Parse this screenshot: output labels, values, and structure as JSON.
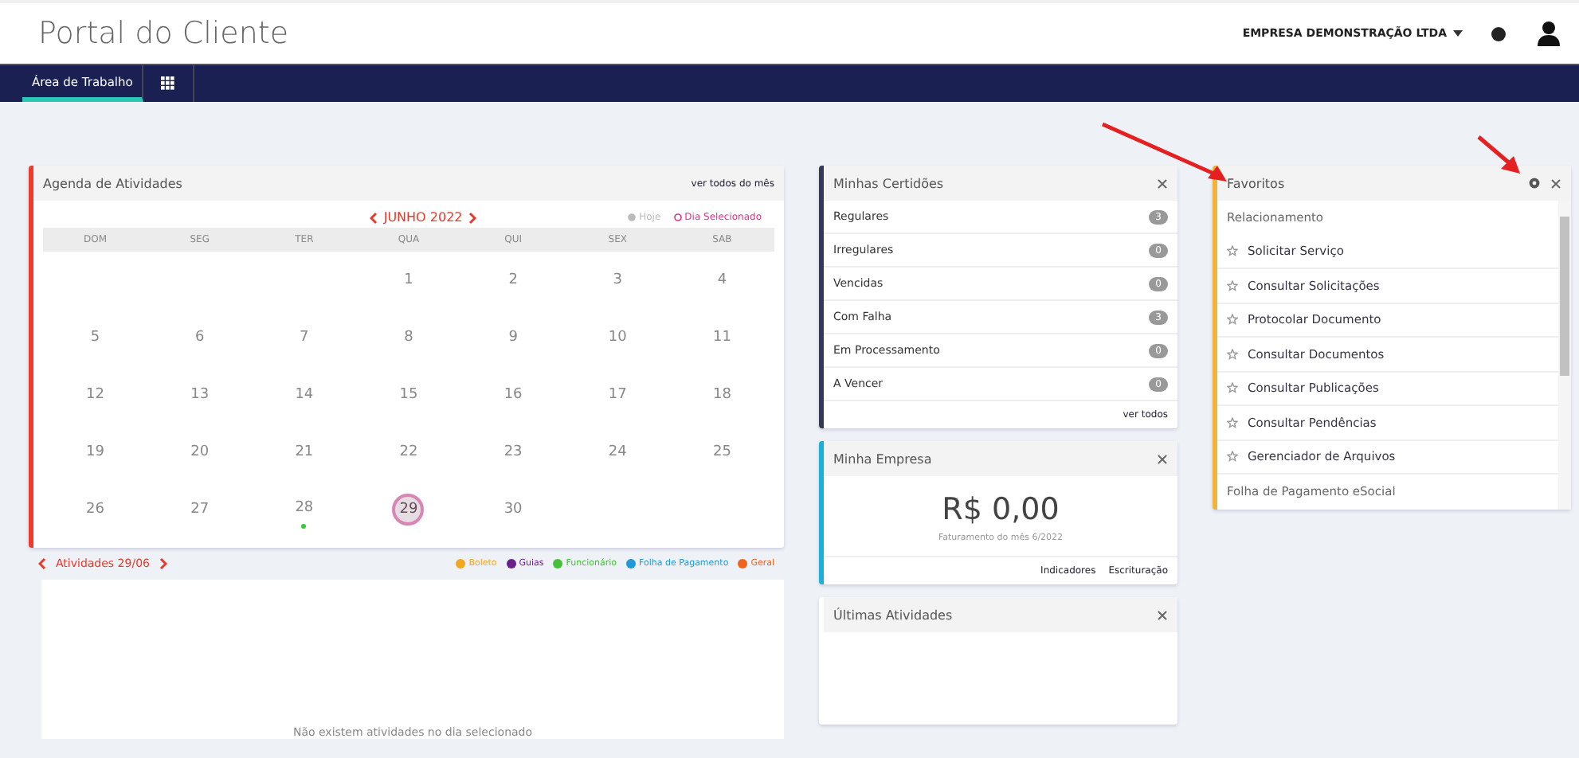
{
  "header": {
    "title": "Portal do Cliente",
    "company": "EMPRESA DEMONSTRAÇÃO LTDA"
  },
  "nav": {
    "tabs": [
      {
        "label": "Área de Trabalho",
        "selected": true
      }
    ]
  },
  "agenda": {
    "title": "Agenda de Atividades",
    "link": "ver todos do mês",
    "month": "JUNHO 2022",
    "legend_today": "Hoje",
    "legend_selected": "Dia Selecionado",
    "weekdays": [
      "DOM",
      "SEG",
      "TER",
      "QUA",
      "QUI",
      "SEX",
      "SAB"
    ],
    "days": [
      {
        "kind": "blank"
      },
      {
        "kind": "blank"
      },
      {
        "kind": "blank"
      },
      {
        "kind": "day",
        "label": "1",
        "selected": false,
        "event": false
      },
      {
        "kind": "day",
        "label": "2",
        "selected": false,
        "event": false
      },
      {
        "kind": "day",
        "label": "3",
        "selected": false,
        "event": false
      },
      {
        "kind": "day",
        "label": "4",
        "selected": false,
        "event": false
      },
      {
        "kind": "day",
        "label": "5",
        "selected": false,
        "event": false
      },
      {
        "kind": "day",
        "label": "6",
        "selected": false,
        "event": false
      },
      {
        "kind": "day",
        "label": "7",
        "selected": false,
        "event": false
      },
      {
        "kind": "day",
        "label": "8",
        "selected": false,
        "event": false
      },
      {
        "kind": "day",
        "label": "9",
        "selected": false,
        "event": false
      },
      {
        "kind": "day",
        "label": "10",
        "selected": false,
        "event": false
      },
      {
        "kind": "day",
        "label": "11",
        "selected": false,
        "event": false
      },
      {
        "kind": "day",
        "label": "12",
        "selected": false,
        "event": false
      },
      {
        "kind": "day",
        "label": "13",
        "selected": false,
        "event": false
      },
      {
        "kind": "day",
        "label": "14",
        "selected": false,
        "event": false
      },
      {
        "kind": "day",
        "label": "15",
        "selected": false,
        "event": false
      },
      {
        "kind": "day",
        "label": "16",
        "selected": false,
        "event": false
      },
      {
        "kind": "day",
        "label": "17",
        "selected": false,
        "event": false
      },
      {
        "kind": "day",
        "label": "18",
        "selected": false,
        "event": false
      },
      {
        "kind": "day",
        "label": "19",
        "selected": false,
        "event": false
      },
      {
        "kind": "day",
        "label": "20",
        "selected": false,
        "event": false
      },
      {
        "kind": "day",
        "label": "21",
        "selected": false,
        "event": false
      },
      {
        "kind": "day",
        "label": "22",
        "selected": false,
        "event": false
      },
      {
        "kind": "day",
        "label": "23",
        "selected": false,
        "event": false
      },
      {
        "kind": "day",
        "label": "24",
        "selected": false,
        "event": false
      },
      {
        "kind": "day",
        "label": "25",
        "selected": false,
        "event": false
      },
      {
        "kind": "day",
        "label": "26",
        "selected": false,
        "event": false
      },
      {
        "kind": "day",
        "label": "27",
        "selected": false,
        "event": false
      },
      {
        "kind": "day",
        "label": "28",
        "selected": false,
        "event": true
      },
      {
        "kind": "day",
        "label": "29",
        "selected": true,
        "event": false
      },
      {
        "kind": "day",
        "label": "30",
        "selected": false,
        "event": false
      }
    ]
  },
  "activities": {
    "title": "Atividades 29/06",
    "empty": "Não existem atividades no dia selecionado",
    "legend": [
      {
        "label": "Boleto",
        "color": "#f2a623"
      },
      {
        "label": "Guias",
        "color": "#6b1f8c"
      },
      {
        "label": "Funcionário",
        "color": "#45c037"
      },
      {
        "label": "Folha de Pagamento",
        "color": "#1f9ad6"
      },
      {
        "label": "Geral",
        "color": "#f0621e"
      }
    ]
  },
  "certidoes": {
    "title": "Minhas Certidões",
    "link": "ver todos",
    "rows": [
      {
        "label": "Regulares",
        "count": "3"
      },
      {
        "label": "Irregulares",
        "count": "0"
      },
      {
        "label": "Vencidas",
        "count": "0"
      },
      {
        "label": "Com Falha",
        "count": "3"
      },
      {
        "label": "Em Processamento",
        "count": "0"
      },
      {
        "label": "A Vencer",
        "count": "0"
      }
    ]
  },
  "empresa": {
    "title": "Minha Empresa",
    "value": "R$ 0,00",
    "caption": "Faturamento do mês 6/2022",
    "links": [
      "Indicadores",
      "Escrituração"
    ]
  },
  "ultimas": {
    "title": "Últimas Atividades"
  },
  "favoritos": {
    "title": "Favoritos",
    "items": [
      {
        "kind": "group",
        "label": "Relacionamento"
      },
      {
        "kind": "link",
        "label": "Solicitar Serviço"
      },
      {
        "kind": "link",
        "label": "Consultar Solicitações"
      },
      {
        "kind": "link",
        "label": "Protocolar Documento"
      },
      {
        "kind": "link",
        "label": "Consultar Documentos"
      },
      {
        "kind": "link",
        "label": "Consultar Publicações"
      },
      {
        "kind": "link",
        "label": "Consultar Pendências"
      },
      {
        "kind": "link",
        "label": "Gerenciador de Arquivos"
      },
      {
        "kind": "group",
        "label": "Folha de Pagamento eSocial"
      }
    ]
  }
}
